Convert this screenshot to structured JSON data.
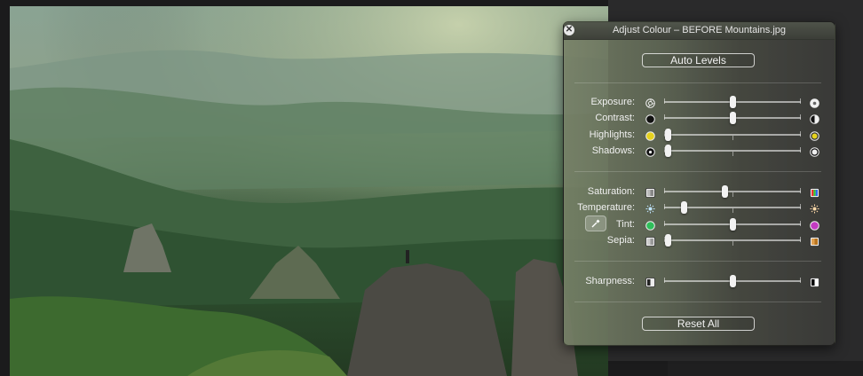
{
  "window": {
    "title": "Adjust Colour – BEFORE Mountains.jpg",
    "close_glyph": "✕"
  },
  "buttons": {
    "auto_levels": "Auto Levels",
    "reset_all": "Reset All"
  },
  "groups": [
    {
      "rows": [
        {
          "id": "exposure",
          "label": "Exposure:",
          "value": 0.5,
          "icon_left": "aperture-small-icon",
          "icon_right": "aperture-large-icon"
        },
        {
          "id": "contrast",
          "label": "Contrast:",
          "value": 0.5,
          "icon_left": "contrast-low-icon",
          "icon_right": "contrast-high-icon"
        },
        {
          "id": "highlights",
          "label": "Highlights:",
          "value": 0.0,
          "icon_left": "highlights-low-icon",
          "icon_right": "highlights-high-icon"
        },
        {
          "id": "shadows",
          "label": "Shadows:",
          "value": 0.0,
          "icon_left": "shadows-low-icon",
          "icon_right": "shadows-high-icon"
        }
      ]
    },
    {
      "rows": [
        {
          "id": "saturation",
          "label": "Saturation:",
          "value": 0.44,
          "icon_left": "saturation-low-icon",
          "icon_right": "saturation-high-icon"
        },
        {
          "id": "temperature",
          "label": "Temperature:",
          "value": 0.12,
          "icon_left": "sun-cool-icon",
          "icon_right": "sun-warm-icon"
        },
        {
          "id": "tint",
          "label": "Tint:",
          "value": 0.5,
          "icon_left": "tint-green-icon",
          "icon_right": "tint-magenta-icon"
        },
        {
          "id": "sepia",
          "label": "Sepia:",
          "value": 0.0,
          "icon_left": "sepia-low-icon",
          "icon_right": "sepia-high-icon"
        }
      ]
    },
    {
      "rows": [
        {
          "id": "sharpness",
          "label": "Sharpness:",
          "value": 0.5,
          "icon_left": "sharpness-low-icon",
          "icon_right": "sharpness-high-icon"
        }
      ]
    }
  ],
  "colors": {
    "highlights_yellow": "#e6d21e",
    "tint_green": "#2fbf5a",
    "tint_magenta": "#c33bc2",
    "sepia_brown": "#b8741e"
  }
}
